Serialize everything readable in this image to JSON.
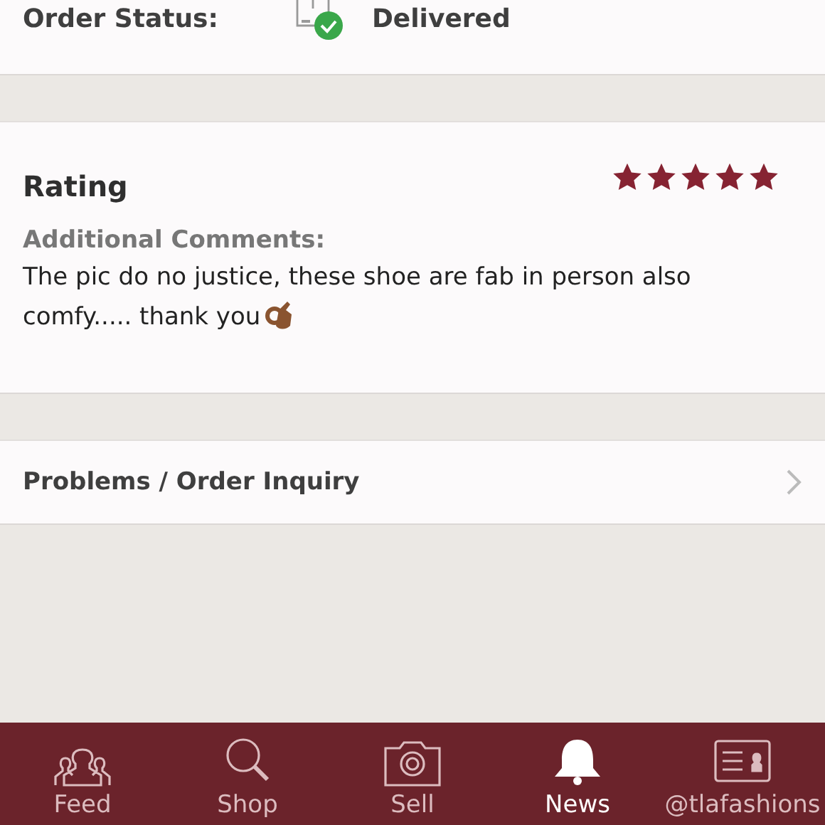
{
  "order_status": {
    "label": "Order Status:",
    "value": "Delivered"
  },
  "rating": {
    "title": "Rating",
    "stars": 5,
    "comments_label": "Additional Comments:",
    "comment": "The pic do no justice, these shoe are fab in person also comfy..... thank you"
  },
  "inquiry": {
    "label": "Problems / Order Inquiry"
  },
  "tabs": [
    {
      "label": "Feed",
      "kind": "people",
      "selected": false
    },
    {
      "label": "Shop",
      "kind": "search",
      "selected": false
    },
    {
      "label": "Sell",
      "kind": "camera",
      "selected": false
    },
    {
      "label": "News",
      "kind": "bell",
      "selected": true
    },
    {
      "label": "@tlafashions",
      "kind": "card",
      "selected": false
    }
  ]
}
